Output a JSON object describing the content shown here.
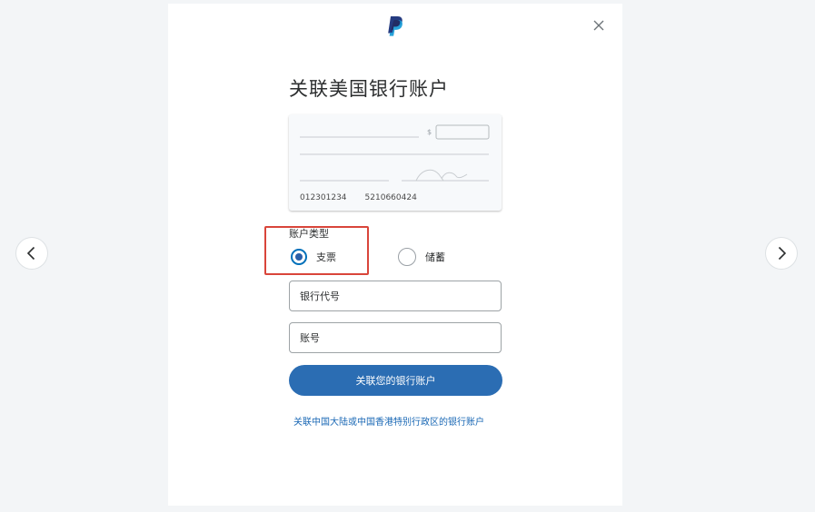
{
  "modal": {
    "title": "关联美国银行账户",
    "close_icon": "close-icon",
    "logo_icon": "paypal-logo-icon"
  },
  "check": {
    "dollar_sign": "$",
    "routing_number": "012301234",
    "account_number": "5210660424"
  },
  "account_type": {
    "label": "账户类型",
    "options": [
      {
        "label": "支票",
        "selected": true
      },
      {
        "label": "储蓄",
        "selected": false
      }
    ]
  },
  "form": {
    "routing_placeholder": "银行代号",
    "account_placeholder": "账号",
    "submit_label": "关联您的银行账户"
  },
  "footer_link": "关联中国大陆或中国香港特别行政区的银行账户",
  "navigation": {
    "prev_icon": "chevron-left-icon",
    "next_icon": "chevron-right-icon"
  },
  "colors": {
    "primary": "#2b6db3",
    "link": "#1a68b5",
    "highlight": "#d9453a"
  }
}
